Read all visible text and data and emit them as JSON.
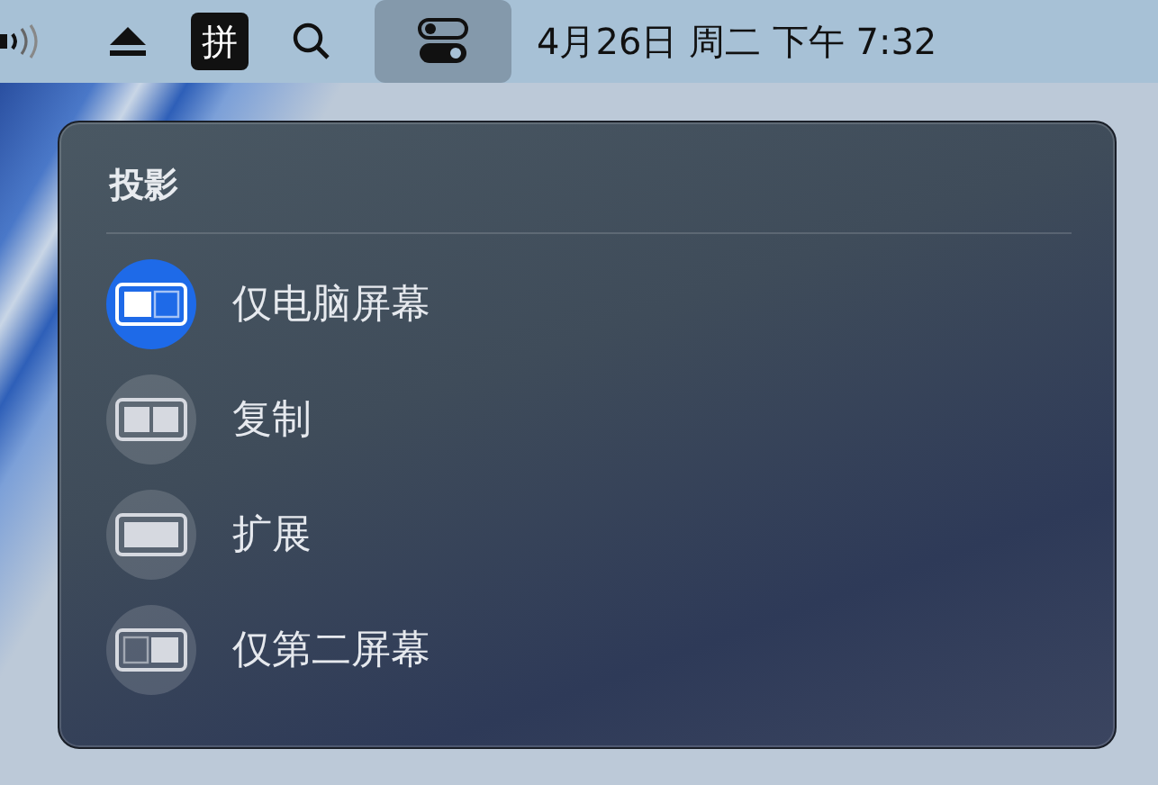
{
  "menu_bar": {
    "input_method": "拼",
    "clock": "4月26日 周二 下午 7:32",
    "control_center_open": true
  },
  "panel": {
    "title": "投影",
    "items": [
      {
        "label": "仅电脑屏幕",
        "kind": "main-only",
        "selected": true
      },
      {
        "label": "复制",
        "kind": "mirror",
        "selected": false
      },
      {
        "label": "扩展",
        "kind": "extend",
        "selected": false
      },
      {
        "label": "仅第二屏幕",
        "kind": "second-only",
        "selected": false
      }
    ]
  }
}
